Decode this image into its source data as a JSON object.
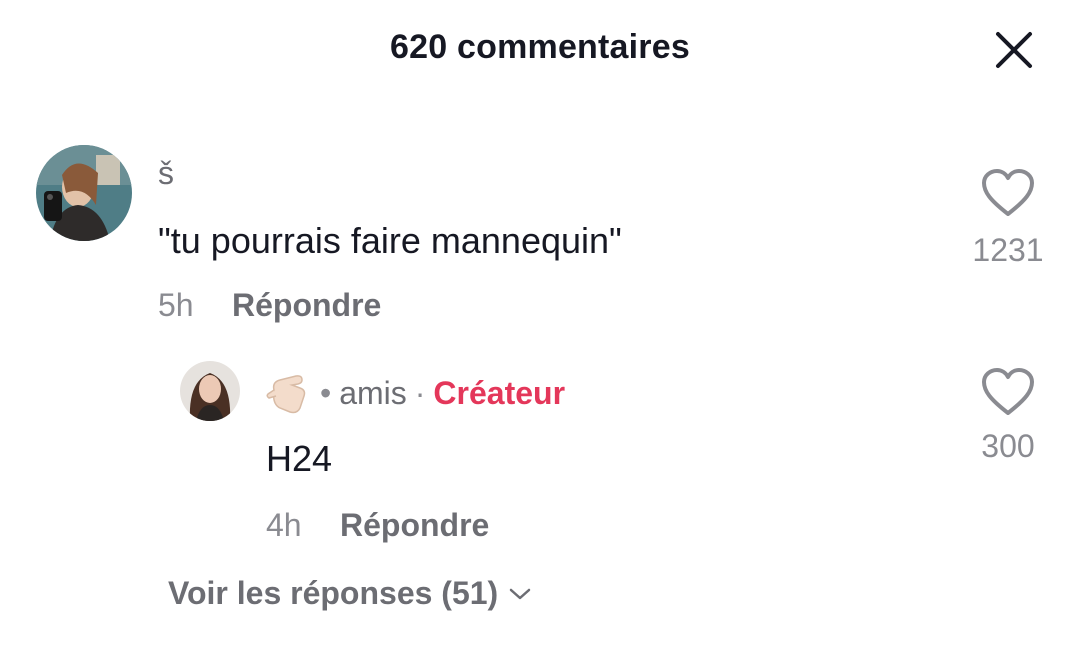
{
  "header": {
    "title": "620 commentaires",
    "close_icon": "close-icon"
  },
  "comments": [
    {
      "username": "š",
      "text": "\"tu pourrais faire mannequin\"",
      "time": "5h",
      "reply_label": "Répondre",
      "likes": "1231",
      "like_icon": "heart-outline-icon"
    }
  ],
  "reply": {
    "emoji_icon": "hand-emoji-icon",
    "separator": "•",
    "relation": "amis",
    "separator2": "·",
    "creator_label": "Créateur",
    "text": "H24",
    "time": "4h",
    "reply_label": "Répondre",
    "likes": "300",
    "like_icon": "heart-outline-icon"
  },
  "view_replies": {
    "label": "Voir les réponses (51)",
    "icon": "chevron-down-icon"
  },
  "colors": {
    "creator": "#e4375a",
    "primary_text": "#161823",
    "secondary_text": "#8a8b91"
  }
}
